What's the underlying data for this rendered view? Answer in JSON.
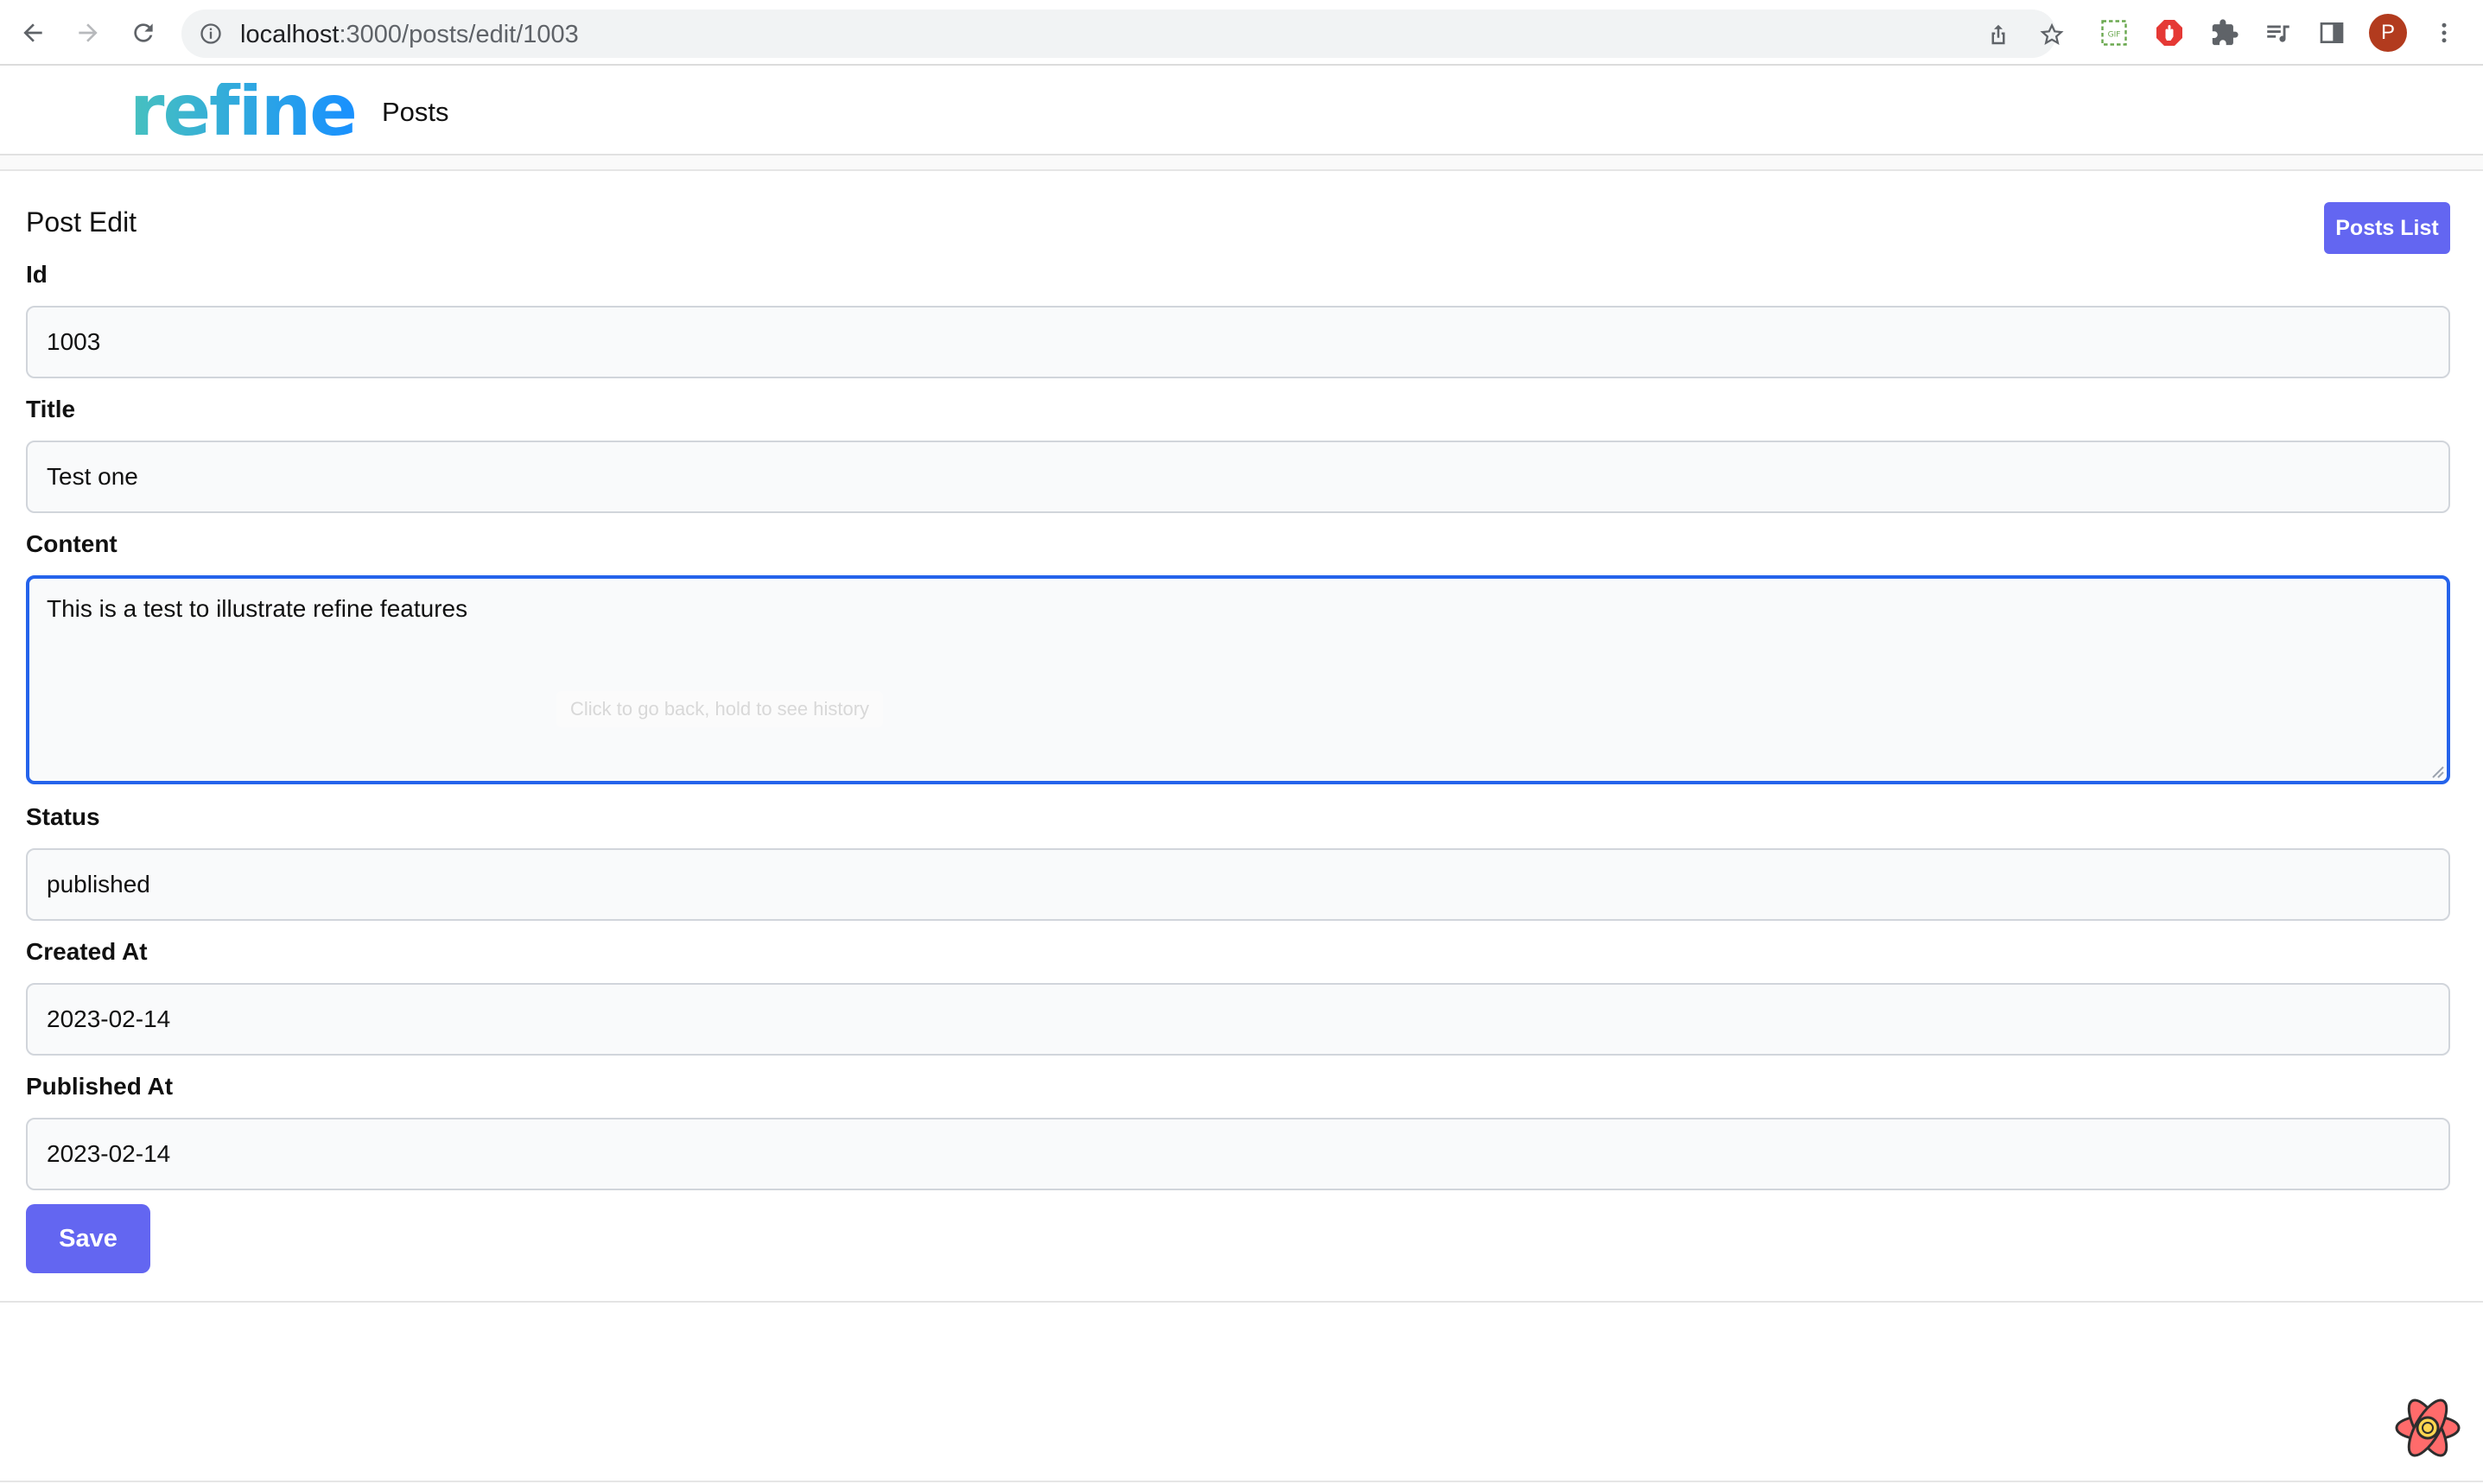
{
  "browser": {
    "url_host": "localhost",
    "url_path": ":3000/posts/edit/1003",
    "avatar_letter": "P"
  },
  "header": {
    "logo_text": "refine",
    "nav_item": "Posts"
  },
  "page": {
    "title": "Post Edit",
    "list_button": "Posts List",
    "save_button": "Save"
  },
  "form": {
    "id": {
      "label": "Id",
      "value": "1003"
    },
    "title": {
      "label": "Title",
      "value": "Test one"
    },
    "content": {
      "label": "Content",
      "value": "This is a test to illustrate refine features"
    },
    "status": {
      "label": "Status",
      "value": "published"
    },
    "created_at": {
      "label": "Created At",
      "value": "2023-02-14"
    },
    "published_at": {
      "label": "Published At",
      "value": "2023-02-14"
    }
  },
  "tooltip": "Click to go back, hold to see history",
  "colors": {
    "accent": "#6366f1",
    "focus_border": "#2563eb",
    "logo_teal": "#47c1bf",
    "logo_blue": "#1890ff",
    "avatar": "#b23b1e"
  },
  "icons": [
    "back-arrow-icon",
    "forward-arrow-icon",
    "reload-icon",
    "site-info-icon",
    "share-icon",
    "bookmark-star-icon",
    "gif-extension-icon",
    "adblock-extension-icon",
    "puzzle-extensions-icon",
    "media-queue-icon",
    "side-panel-icon",
    "kebab-menu-icon",
    "react-query-devtools-icon"
  ]
}
